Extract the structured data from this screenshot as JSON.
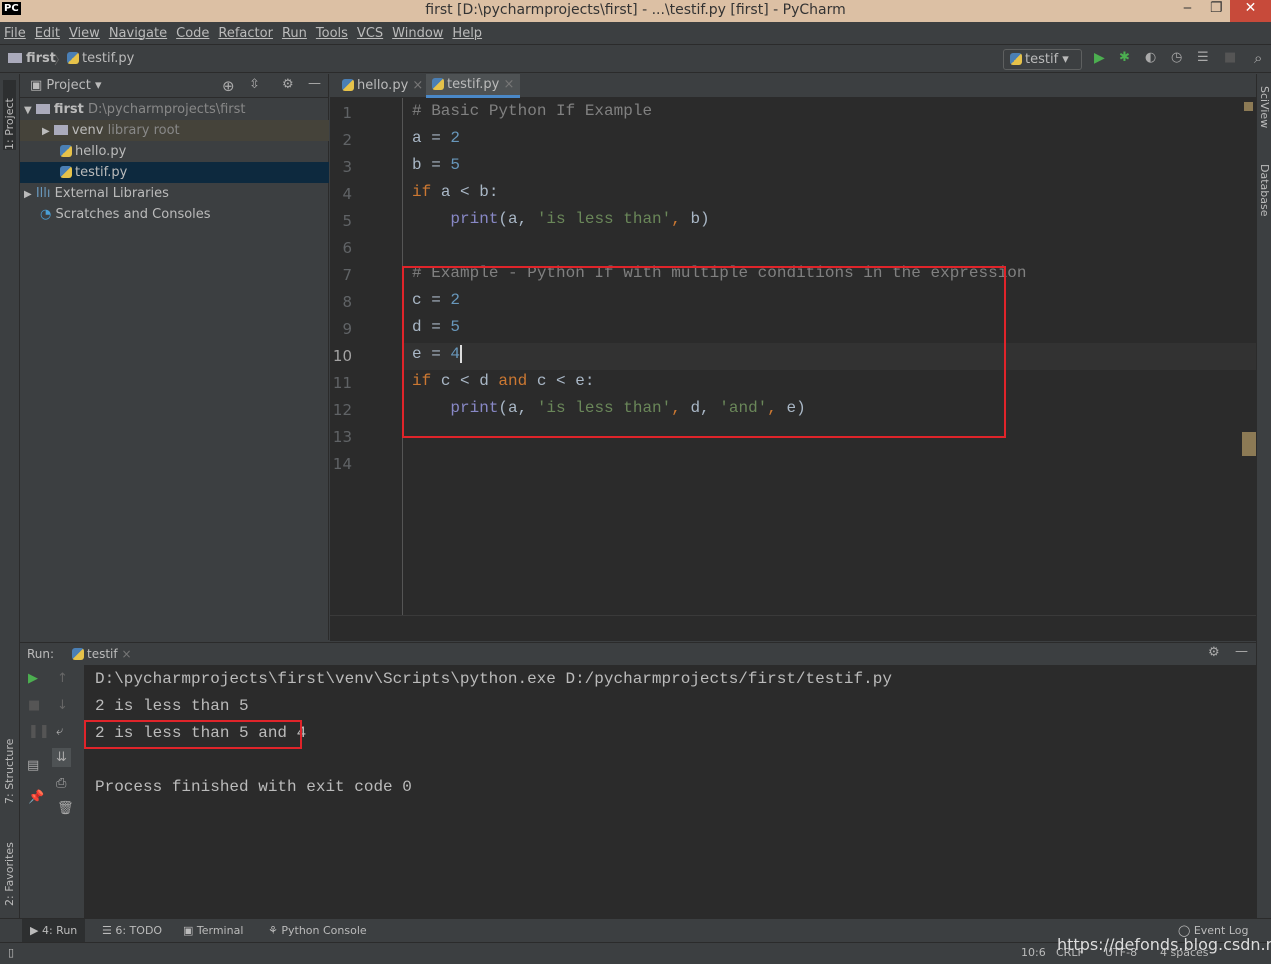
{
  "window": {
    "title": "first [D:\\pycharmprojects\\first] - ...\\testif.py [first] - PyCharm",
    "app_icon": "PC"
  },
  "menu": [
    "File",
    "Edit",
    "View",
    "Navigate",
    "Code",
    "Refactor",
    "Run",
    "Tools",
    "VCS",
    "Window",
    "Help"
  ],
  "breadcrumb": {
    "project": "first",
    "file": "testif.py"
  },
  "run_config": {
    "label": "testif"
  },
  "left_strip": {
    "project": "1: Project",
    "structure": "7: Structure",
    "favorites": "2: Favorites"
  },
  "right_strip": {
    "sciview": "SciView",
    "database": "Database"
  },
  "project_panel": {
    "title": "Project",
    "tree": [
      {
        "label": "first",
        "hint": "D:\\pycharmprojects\\first",
        "type": "folder"
      },
      {
        "label": "venv",
        "hint": "library root",
        "type": "folder"
      },
      {
        "label": "hello.py",
        "type": "python"
      },
      {
        "label": "testif.py",
        "type": "python",
        "selected": true
      },
      {
        "label": "External Libraries",
        "type": "library"
      },
      {
        "label": "Scratches and Consoles",
        "type": "scratch"
      }
    ]
  },
  "editor": {
    "tabs": [
      {
        "label": "hello.py"
      },
      {
        "label": "testif.py",
        "active": true
      }
    ],
    "lines": [
      [
        [
          "cm",
          "# Basic Python If Example"
        ]
      ],
      [
        [
          "pl",
          "a = "
        ],
        [
          "nm",
          "2"
        ]
      ],
      [
        [
          "pl",
          "b = "
        ],
        [
          "nm",
          "5"
        ]
      ],
      [
        [
          "kw",
          "if "
        ],
        [
          "pl",
          "a < b:"
        ]
      ],
      [
        [
          "pl",
          "    "
        ],
        [
          "bi",
          "print"
        ],
        [
          "pl",
          "(a, "
        ],
        [
          "st",
          "'is less than'"
        ],
        [
          "kw",
          ", "
        ],
        [
          "pl",
          "b)"
        ]
      ],
      [],
      [
        [
          "cm",
          "# Example - Python If with multiple conditions in the expression"
        ]
      ],
      [
        [
          "pl",
          "c = "
        ],
        [
          "nm",
          "2"
        ]
      ],
      [
        [
          "pl",
          "d = "
        ],
        [
          "nm",
          "5"
        ]
      ],
      [
        [
          "pl",
          "e = "
        ],
        [
          "nm",
          "4"
        ]
      ],
      [
        [
          "kw",
          "if "
        ],
        [
          "pl",
          "c < d "
        ],
        [
          "kw",
          "and "
        ],
        [
          "pl",
          "c < e:"
        ]
      ],
      [
        [
          "pl",
          "    "
        ],
        [
          "bi",
          "print"
        ],
        [
          "pl",
          "(a, "
        ],
        [
          "st",
          "'is less than'"
        ],
        [
          "kw",
          ", "
        ],
        [
          "pl",
          "d, "
        ],
        [
          "st",
          "'and'"
        ],
        [
          "kw",
          ", "
        ],
        [
          "pl",
          "e)"
        ]
      ],
      [],
      []
    ],
    "current_line": 10
  },
  "run_panel": {
    "label": "Run:",
    "tab": "testif",
    "output": [
      "D:\\pycharmprojects\\first\\venv\\Scripts\\python.exe D:/pycharmprojects/first/testif.py",
      "2 is less than 5",
      "2 is less than 5 and 4",
      "",
      "Process finished with exit code 0"
    ]
  },
  "bottom_tools": [
    "4: Run",
    "6: TODO",
    "Terminal",
    "Python Console"
  ],
  "event_log": "Event Log",
  "status": {
    "position": "10:6",
    "line_sep": "CRLF",
    "encoding": "UTF-8",
    "indent": "4 spaces"
  },
  "watermark": "https://defonds.blog.csdn.net",
  "colors": {
    "highlight": "#e0242a",
    "keyword": "#cc7832",
    "number": "#6897bb",
    "string": "#6a8759",
    "comment": "#808080"
  }
}
